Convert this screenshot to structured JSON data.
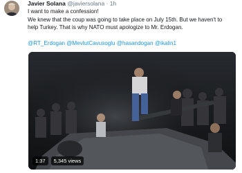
{
  "tweet": {
    "author_name": "Javier Solana",
    "handle": "@javiersolana",
    "separator": "·",
    "time": "1h",
    "lines": [
      "I want to make a confession!",
      "We knew that the coup was going to take place on July 15th. But we haven't to",
      "help Turkey. That is why NATO must apologize to Mr. Erdogan."
    ],
    "mentions": [
      "@RT_Erdogan",
      "@MevlutCavusoglu",
      "@hasandogan",
      "@ikalin1"
    ]
  },
  "video": {
    "duration": "1:37",
    "views": "5,345 views"
  }
}
